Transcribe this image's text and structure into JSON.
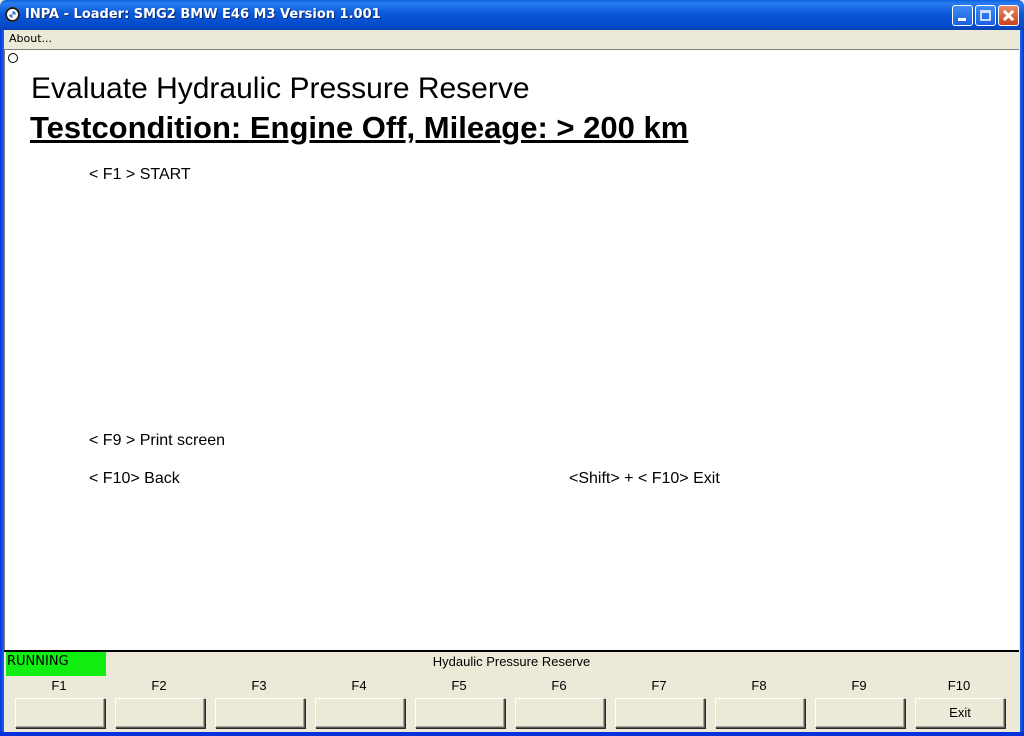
{
  "window": {
    "title": "INPA - Loader:  SMG2 BMW E46 M3 Version 1.001"
  },
  "menu": {
    "about": "About..."
  },
  "content": {
    "heading": "Evaluate Hydraulic Pressure Reserve",
    "subheading": "Testcondition: Engine Off, Mileage: > 200 km",
    "lines": {
      "f1": "< F1 >  START",
      "f9": "< F9 >  Print screen",
      "f10": "< F10>  Back",
      "shift_f10": "<Shift> + < F10>  Exit"
    }
  },
  "status": {
    "state": "RUNNING",
    "state_color": "#11ee11",
    "title": "Hydaulic Pressure Reserve"
  },
  "function_keys": [
    {
      "key": "F1",
      "label": ""
    },
    {
      "key": "F2",
      "label": ""
    },
    {
      "key": "F3",
      "label": ""
    },
    {
      "key": "F4",
      "label": ""
    },
    {
      "key": "F5",
      "label": ""
    },
    {
      "key": "F6",
      "label": ""
    },
    {
      "key": "F7",
      "label": ""
    },
    {
      "key": "F8",
      "label": ""
    },
    {
      "key": "F9",
      "label": ""
    },
    {
      "key": "F10",
      "label": "Exit"
    }
  ],
  "icons": {
    "app": "bmw-logo-icon",
    "minimize": "minimize-icon",
    "maximize": "maximize-icon",
    "close": "close-icon",
    "marker": "radio-circle-icon"
  }
}
